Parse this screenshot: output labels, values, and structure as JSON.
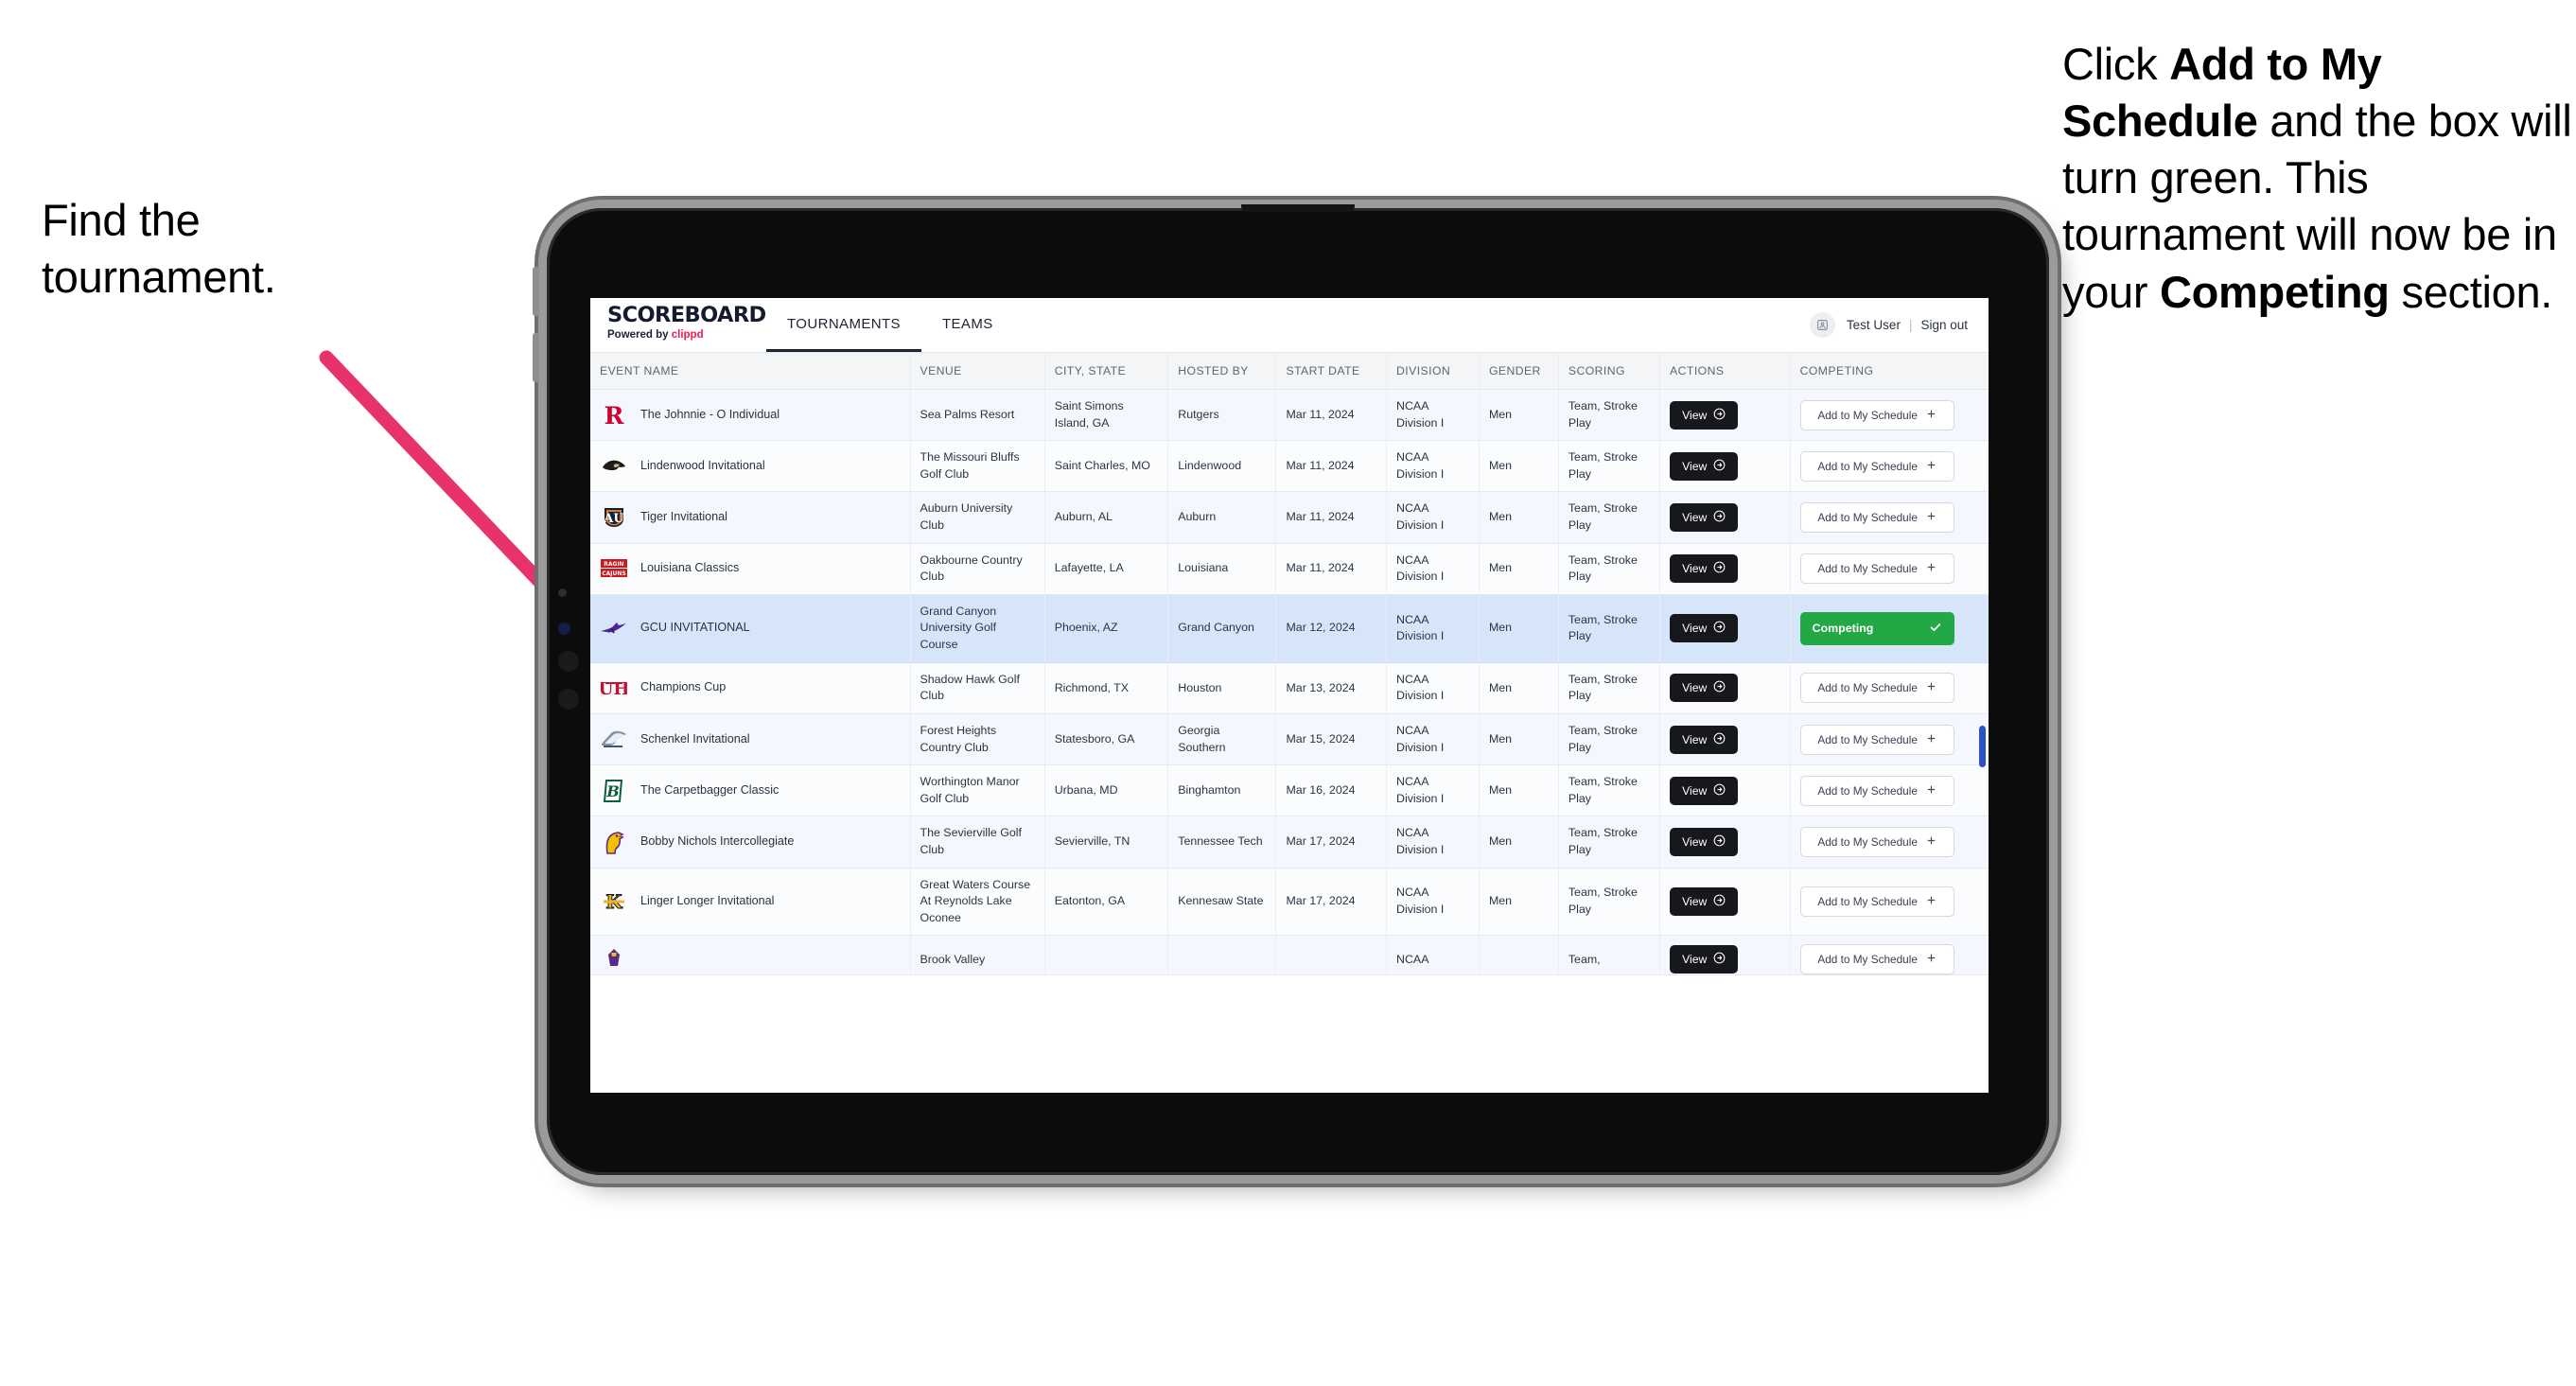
{
  "annotations": {
    "left": {
      "line1": "Find the",
      "line2": "tournament."
    },
    "right": {
      "seg1": "Click ",
      "bold1": "Add to My Schedule",
      "seg2": " and the box will turn green. This tournament will now be in your ",
      "bold2": "Competing",
      "seg3": " section."
    },
    "arrow_color": "#e8336a"
  },
  "app": {
    "brand": {
      "title": "SCOREBOARD",
      "powered_prefix": "Powered by ",
      "powered_name": "clippd"
    },
    "nav": [
      {
        "label": "TOURNAMENTS",
        "active": true
      },
      {
        "label": "TEAMS",
        "active": false
      }
    ],
    "user": {
      "name": "Test User",
      "separator": "|",
      "signout": "Sign out",
      "avatar_icon": "user-avatar-icon"
    },
    "table": {
      "columns": [
        "EVENT NAME",
        "VENUE",
        "CITY, STATE",
        "HOSTED BY",
        "START DATE",
        "DIVISION",
        "GENDER",
        "SCORING",
        "ACTIONS",
        "COMPETING"
      ],
      "action_label": "View",
      "add_label": "Add to My Schedule",
      "competing_label": "Competing",
      "competing_color": "#22a845",
      "selected_row_color": "#d7e5fb",
      "rows": [
        {
          "logo": "rutgers-logo",
          "event": "The Johnnie - O Individual",
          "venue": "Sea Palms Resort",
          "city": "Saint Simons Island, GA",
          "host": "Rutgers",
          "date": "Mar 11, 2024",
          "division": "NCAA Division I",
          "gender": "Men",
          "scoring": "Team, Stroke Play",
          "competing": false
        },
        {
          "logo": "lindenwood-logo",
          "event": "Lindenwood Invitational",
          "venue": "The Missouri Bluffs Golf Club",
          "city": "Saint Charles, MO",
          "host": "Lindenwood",
          "date": "Mar 11, 2024",
          "division": "NCAA Division I",
          "gender": "Men",
          "scoring": "Team, Stroke Play",
          "competing": false
        },
        {
          "logo": "auburn-logo",
          "event": "Tiger Invitational",
          "venue": "Auburn University Club",
          "city": "Auburn, AL",
          "host": "Auburn",
          "date": "Mar 11, 2024",
          "division": "NCAA Division I",
          "gender": "Men",
          "scoring": "Team, Stroke Play",
          "competing": false
        },
        {
          "logo": "louisiana-logo",
          "event": "Louisiana Classics",
          "venue": "Oakbourne Country Club",
          "city": "Lafayette, LA",
          "host": "Louisiana",
          "date": "Mar 11, 2024",
          "division": "NCAA Division I",
          "gender": "Men",
          "scoring": "Team, Stroke Play",
          "competing": false
        },
        {
          "logo": "grandcanyon-logo",
          "event": "GCU INVITATIONAL",
          "venue": "Grand Canyon University Golf Course",
          "city": "Phoenix, AZ",
          "host": "Grand Canyon",
          "date": "Mar 12, 2024",
          "division": "NCAA Division I",
          "gender": "Men",
          "scoring": "Team, Stroke Play",
          "competing": true
        },
        {
          "logo": "houston-logo",
          "event": "Champions Cup",
          "venue": "Shadow Hawk Golf Club",
          "city": "Richmond, TX",
          "host": "Houston",
          "date": "Mar 13, 2024",
          "division": "NCAA Division I",
          "gender": "Men",
          "scoring": "Team, Stroke Play",
          "competing": false
        },
        {
          "logo": "georgiasouthern-logo",
          "event": "Schenkel Invitational",
          "venue": "Forest Heights Country Club",
          "city": "Statesboro, GA",
          "host": "Georgia Southern",
          "date": "Mar 15, 2024",
          "division": "NCAA Division I",
          "gender": "Men",
          "scoring": "Team, Stroke Play",
          "competing": false
        },
        {
          "logo": "binghamton-logo",
          "event": "The Carpetbagger Classic",
          "venue": "Worthington Manor Golf Club",
          "city": "Urbana, MD",
          "host": "Binghamton",
          "date": "Mar 16, 2024",
          "division": "NCAA Division I",
          "gender": "Men",
          "scoring": "Team, Stroke Play",
          "competing": false
        },
        {
          "logo": "tennesseetech-logo",
          "event": "Bobby Nichols Intercollegiate",
          "venue": "The Sevierville Golf Club",
          "city": "Sevierville, TN",
          "host": "Tennessee Tech",
          "date": "Mar 17, 2024",
          "division": "NCAA Division I",
          "gender": "Men",
          "scoring": "Team, Stroke Play",
          "competing": false
        },
        {
          "logo": "kennesaw-logo",
          "event": "Linger Longer Invitational",
          "venue": "Great Waters Course At Reynolds Lake Oconee",
          "city": "Eatonton, GA",
          "host": "Kennesaw State",
          "date": "Mar 17, 2024",
          "division": "NCAA Division I",
          "gender": "Men",
          "scoring": "Team, Stroke Play",
          "competing": false
        },
        {
          "logo": "eastcarolina-logo",
          "event": "",
          "venue": "Brook Valley",
          "city": "",
          "host": "",
          "date": "",
          "division": "NCAA",
          "gender": "",
          "scoring": "Team,",
          "competing": false,
          "partial": true
        }
      ]
    }
  }
}
